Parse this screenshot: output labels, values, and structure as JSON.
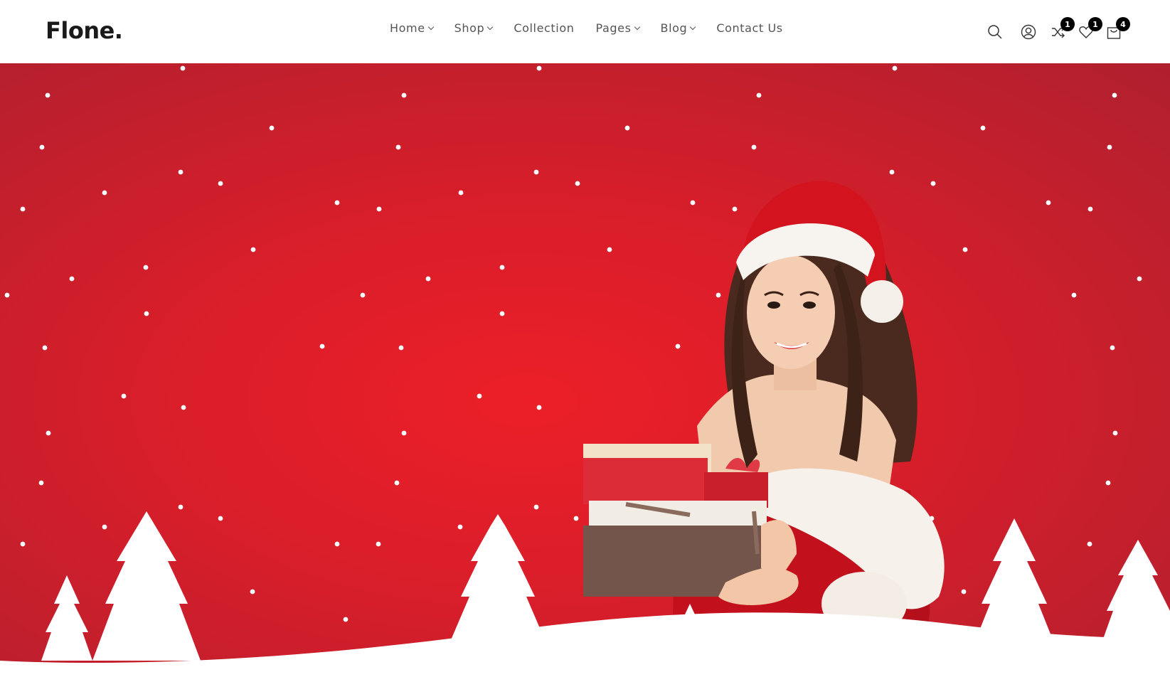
{
  "brand": {
    "logo": "Flone."
  },
  "nav": {
    "items": [
      {
        "label": "Home",
        "has_dropdown": true
      },
      {
        "label": "Shop",
        "has_dropdown": true
      },
      {
        "label": "Collection",
        "has_dropdown": false
      },
      {
        "label": "Pages",
        "has_dropdown": true
      },
      {
        "label": "Blog",
        "has_dropdown": true
      },
      {
        "label": "Contact Us",
        "has_dropdown": false
      }
    ]
  },
  "header_icons": {
    "search": {
      "icon": "search-icon"
    },
    "account": {
      "icon": "user-icon"
    },
    "compare": {
      "icon": "shuffle-icon",
      "count": "1"
    },
    "wishlist": {
      "icon": "heart-icon",
      "count": "1"
    },
    "cart": {
      "icon": "shopping-bag-icon",
      "count": "4"
    }
  },
  "hero": {
    "background_color": "#d91e2a",
    "image": "woman-in-santa-hat-holding-gift-boxes"
  }
}
